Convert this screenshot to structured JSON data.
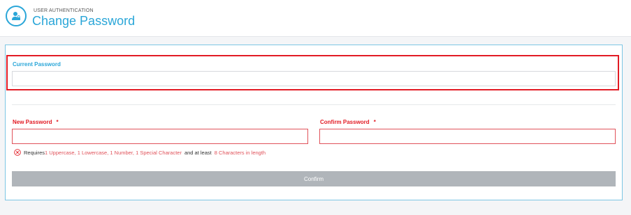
{
  "header": {
    "section": "USER AUTHENTICATION",
    "title": "Change Password",
    "icon": "user-lock-icon"
  },
  "form": {
    "current_password": {
      "label": "Current Password",
      "value": ""
    },
    "new_password": {
      "label": "New Password",
      "required_mark": "*",
      "value": ""
    },
    "confirm_password": {
      "label": "Confirm Password",
      "required_mark": "*",
      "value": ""
    },
    "requirements": {
      "icon": "error-circle-icon",
      "prefix": "Requires",
      "rules": "1 Uppercase, 1 Lowercase, 1 Number, 1 Special Character",
      "middle": "and at least",
      "length": "8 Characters in length"
    },
    "confirm_label": "Confirm"
  },
  "colors": {
    "accent": "#2aa6d8",
    "error": "#e21b24",
    "button_disabled": "#b0b5ba"
  }
}
